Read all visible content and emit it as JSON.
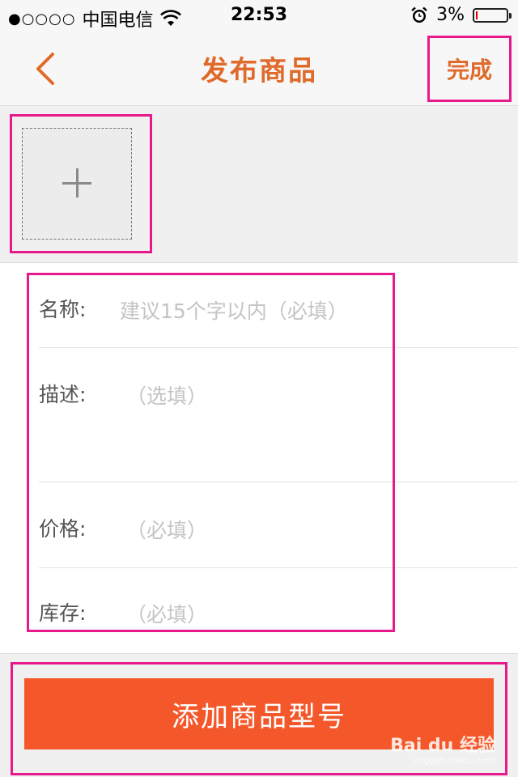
{
  "status_bar": {
    "signal": "●○○○○",
    "carrier": "中国电信",
    "time": "22:53",
    "battery_text": "3%",
    "battery_level": 0.03
  },
  "nav": {
    "title": "发布商品",
    "done_label": "完成"
  },
  "form": {
    "fields": [
      {
        "label": "名称:",
        "placeholder": "建议15个字以内（必填）"
      },
      {
        "label": "描述:",
        "placeholder": "（选填）"
      },
      {
        "label": "价格:",
        "placeholder": "（必填）"
      },
      {
        "label": "库存:",
        "placeholder": "（必填）"
      }
    ]
  },
  "bottom": {
    "add_model_label": "添加商品型号"
  },
  "watermark": {
    "brand": "Bai du 经验",
    "url": "jingyan.baidu.com"
  },
  "colors": {
    "accent": "#e06a2a",
    "button_bg": "#f4582a",
    "highlight": "#e8198b"
  },
  "icons": {
    "back": "chevron-left-icon",
    "wifi": "wifi-icon",
    "alarm": "alarm-clock-icon",
    "add_photo": "plus-icon"
  }
}
